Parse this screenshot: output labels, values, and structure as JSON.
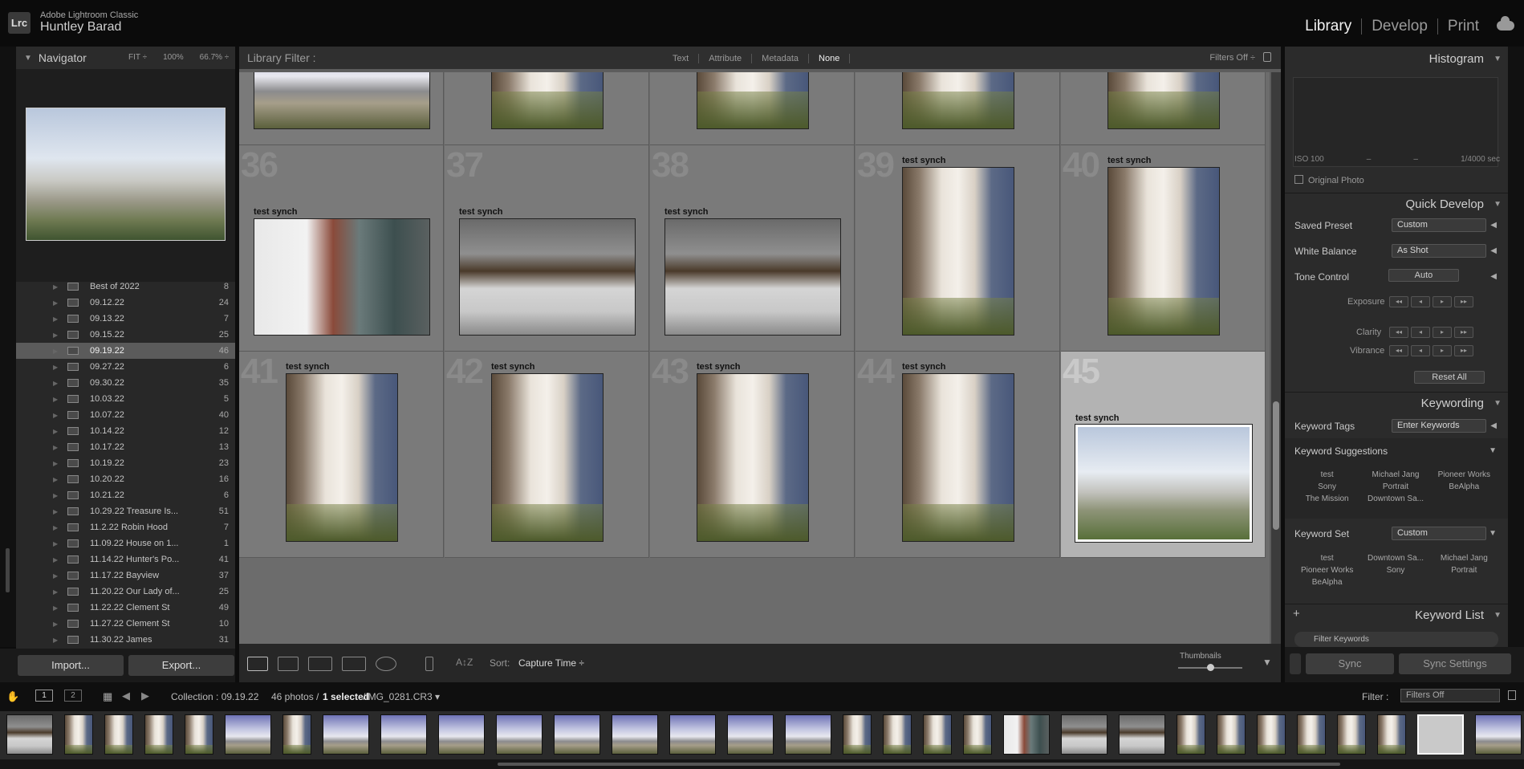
{
  "app": {
    "name": "Adobe Lightroom Classic",
    "user": "Huntley Barad",
    "logo": "Lrc"
  },
  "modules": [
    "Library",
    "Develop",
    "Print"
  ],
  "active_module": "Library",
  "navigator": {
    "title": "Navigator",
    "zoom": [
      "FIT ÷",
      "100%",
      "66.7% ÷"
    ]
  },
  "collections": [
    {
      "name": "Best of 2022",
      "count": "8"
    },
    {
      "name": "09.12.22",
      "count": "24"
    },
    {
      "name": "09.13.22",
      "count": "7"
    },
    {
      "name": "09.15.22",
      "count": "25"
    },
    {
      "name": "09.19.22",
      "count": "46"
    },
    {
      "name": "09.27.22",
      "count": "6"
    },
    {
      "name": "09.30.22",
      "count": "35"
    },
    {
      "name": "10.03.22",
      "count": "5"
    },
    {
      "name": "10.07.22",
      "count": "40"
    },
    {
      "name": "10.14.22",
      "count": "12"
    },
    {
      "name": "10.17.22",
      "count": "13"
    },
    {
      "name": "10.19.22",
      "count": "23"
    },
    {
      "name": "10.20.22",
      "count": "16"
    },
    {
      "name": "10.21.22",
      "count": "6"
    },
    {
      "name": "10.29.22 Treasure Is...",
      "count": "51"
    },
    {
      "name": "11.2.22 Robin Hood",
      "count": "7"
    },
    {
      "name": "11.09.22 House on 1...",
      "count": "1"
    },
    {
      "name": "11.14.22 Hunter's Po...",
      "count": "41"
    },
    {
      "name": "11.17.22 Bayview",
      "count": "37"
    },
    {
      "name": "11.20.22 Our Lady of...",
      "count": "25"
    },
    {
      "name": "11.22.22 Clement St",
      "count": "49"
    },
    {
      "name": "11.27.22 Clement St",
      "count": "10"
    },
    {
      "name": "11.30.22 James",
      "count": "31"
    }
  ],
  "selected_collection": "09.19.22",
  "left_buttons": {
    "import": "Import...",
    "export": "Export..."
  },
  "filter": {
    "label": "Library Filter :",
    "tabs": [
      "Text",
      "Attribute",
      "Metadata",
      "None"
    ],
    "active": "None",
    "filters_off": "Filters Off ÷"
  },
  "grid": {
    "label": "test synch",
    "numbers": [
      "36",
      "37",
      "38",
      "39",
      "40",
      "41",
      "42",
      "43",
      "44",
      "45"
    ]
  },
  "toolbar": {
    "sort_label": "Sort:",
    "sort_value": "Capture Time ÷",
    "thumbs_label": "Thumbnails"
  },
  "histogram": {
    "title": "Histogram",
    "iso": "ISO 100",
    "dash1": "–",
    "dash2": "–",
    "shutter": "1/4000 sec",
    "original_photo": "Original Photo"
  },
  "quick_develop": {
    "title": "Quick Develop",
    "saved_preset_label": "Saved Preset",
    "saved_preset": "Custom",
    "white_balance_label": "White Balance",
    "white_balance": "As Shot",
    "tone_control_label": "Tone Control",
    "auto": "Auto",
    "exposure": "Exposure",
    "clarity": "Clarity",
    "vibrance": "Vibrance",
    "reset_all": "Reset All"
  },
  "keywording": {
    "title": "Keywording",
    "tags_label": "Keyword Tags",
    "tags_value": "Enter Keywords",
    "suggestions_label": "Keyword Suggestions",
    "suggestions": [
      "test",
      "Michael Jang",
      "Pioneer Works",
      "Sony",
      "Portrait",
      "BeAlpha",
      "The Mission",
      "Downtown Sa...",
      ""
    ],
    "set_label": "Keyword Set",
    "set_value": "Custom",
    "set_items": [
      "test",
      "Downtown Sa...",
      "Michael Jang",
      "Pioneer Works",
      "Sony",
      "Portrait",
      "BeAlpha",
      "",
      ""
    ]
  },
  "keyword_list": {
    "title": "Keyword List",
    "filter": "Filter Keywords",
    "plus": "+"
  },
  "sync": {
    "sync": "Sync",
    "sync_settings": "Sync Settings"
  },
  "filmstrip": {
    "page1": "1",
    "page2": "2",
    "collection": "Collection : 09.19.22",
    "photos": "46 photos /",
    "selected": "1 selected",
    "file": "/IMG_0281.CR3 ▾",
    "filter_label": "Filter :",
    "filter_value": "Filters Off"
  }
}
